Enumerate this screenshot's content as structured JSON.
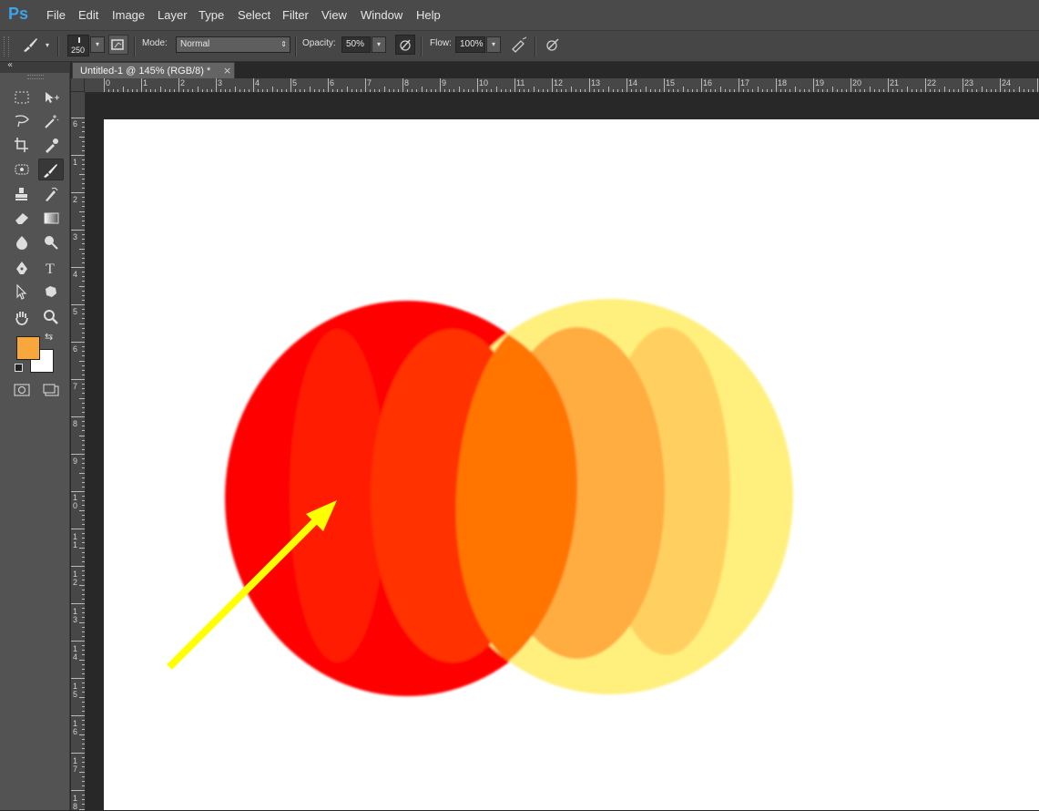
{
  "app": {
    "logo": "Ps"
  },
  "menu": [
    "File",
    "Edit",
    "Image",
    "Layer",
    "Type",
    "Select",
    "Filter",
    "View",
    "Window",
    "Help"
  ],
  "options": {
    "brush_size": "250",
    "mode_label": "Mode:",
    "mode_value": "Normal",
    "opacity_label": "Opacity:",
    "opacity_value": "50%",
    "flow_label": "Flow:",
    "flow_value": "100%"
  },
  "document": {
    "tab_title": "Untitled-1 @ 145% (RGB/8) *",
    "close": "×"
  },
  "ruler": {
    "top": [
      "0",
      "1",
      "2",
      "3",
      "4",
      "5",
      "6",
      "7",
      "8",
      "9",
      "10",
      "11",
      "12",
      "13",
      "14",
      "15",
      "16",
      "17",
      "18",
      "19",
      "20",
      "21",
      "22",
      "23",
      "24"
    ],
    "left": [
      "6",
      "1",
      "2",
      "3",
      "4",
      "5",
      "6",
      "7",
      "8",
      "9",
      "10",
      "11",
      "12",
      "13",
      "14",
      "15",
      "16",
      "17",
      "18"
    ]
  },
  "colors": {
    "foreground": "#f7a73b",
    "background": "#ffffff",
    "red_circle": "#ff0000",
    "yellow_circle": "#fff07e",
    "arrow": "#ffff00",
    "overlap": "#ff7400"
  },
  "toolbar_icons": [
    "rectangular-marquee-icon",
    "move-icon",
    "lasso-icon",
    "magic-wand-icon",
    "crop-icon",
    "eyedropper-icon",
    "healing-brush-icon",
    "brush-icon",
    "clone-stamp-icon",
    "history-brush-icon",
    "eraser-icon",
    "gradient-icon",
    "blur-icon",
    "dodge-icon",
    "pen-icon",
    "type-icon",
    "path-selection-icon",
    "shape-icon",
    "hand-icon",
    "zoom-icon"
  ]
}
